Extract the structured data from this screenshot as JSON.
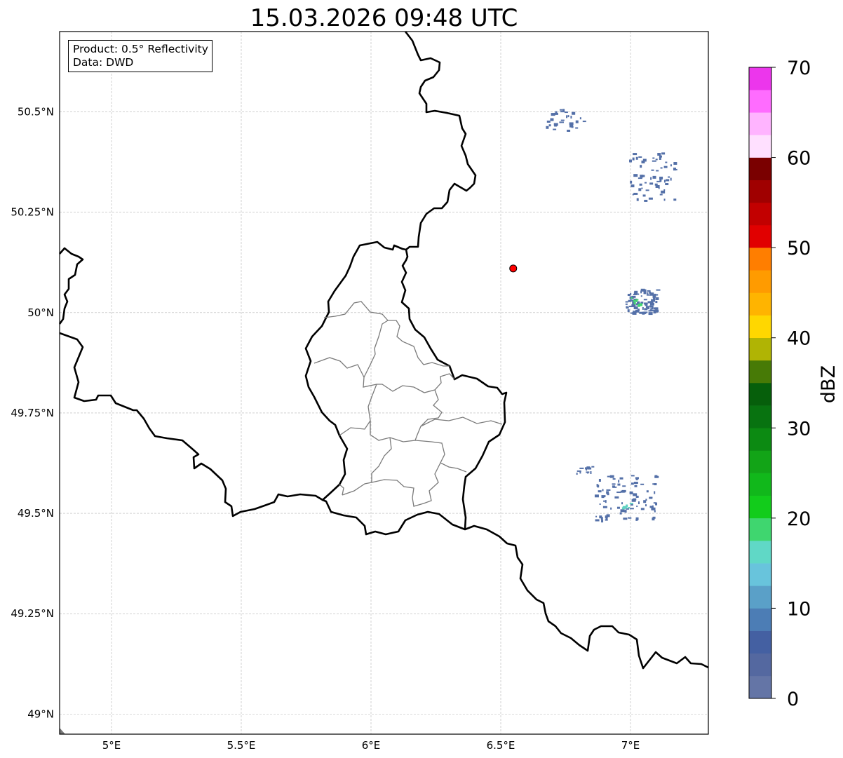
{
  "title": "15.03.2026 09:48 UTC",
  "info_box": {
    "product": "Product: 0.5° Reflectivity",
    "data": "Data: DWD"
  },
  "map": {
    "lon_range": [
      4.8,
      7.3
    ],
    "lat_range": [
      48.95,
      50.7
    ],
    "lon_ticks": [
      {
        "value": 5.0,
        "label": "5°E"
      },
      {
        "value": 5.5,
        "label": "5.5°E"
      },
      {
        "value": 6.0,
        "label": "6°E"
      },
      {
        "value": 6.5,
        "label": "6.5°E"
      },
      {
        "value": 7.0,
        "label": "7°E"
      }
    ],
    "lat_ticks": [
      {
        "value": 49.0,
        "label": "49°N"
      },
      {
        "value": 49.25,
        "label": "49.25°N"
      },
      {
        "value": 49.5,
        "label": "49.5°N"
      },
      {
        "value": 49.75,
        "label": "49.75°N"
      },
      {
        "value": 50.0,
        "label": "50°N"
      },
      {
        "value": 50.25,
        "label": "50.25°N"
      },
      {
        "value": 50.5,
        "label": "50.5°N"
      }
    ],
    "gridlines": true,
    "radar_site": {
      "lon": 6.548,
      "lat": 50.11,
      "color": "#ff0000"
    },
    "echoes": [
      {
        "lon": 6.74,
        "lat": 50.48,
        "spread_lon": 0.08,
        "spread_lat": 0.03,
        "count": 30,
        "color": "#5470a8"
      },
      {
        "lon": 7.08,
        "lat": 50.34,
        "spread_lon": 0.09,
        "spread_lat": 0.06,
        "count": 60,
        "color": "#5470a8"
      },
      {
        "lon": 7.04,
        "lat": 50.03,
        "spread_lon": 0.06,
        "spread_lat": 0.03,
        "count": 90,
        "color": "#5470a8"
      },
      {
        "lon": 7.02,
        "lat": 50.03,
        "spread_lon": 0.02,
        "spread_lat": 0.01,
        "count": 8,
        "color": "#3fd66f"
      },
      {
        "lon": 6.83,
        "lat": 49.61,
        "spread_lon": 0.04,
        "spread_lat": 0.01,
        "count": 12,
        "color": "#5470a8"
      },
      {
        "lon": 6.98,
        "lat": 49.54,
        "spread_lon": 0.12,
        "spread_lat": 0.06,
        "count": 90,
        "color": "#5470a8"
      },
      {
        "lon": 6.98,
        "lat": 49.52,
        "spread_lon": 0.02,
        "spread_lat": 0.01,
        "count": 5,
        "color": "#5fd2c2"
      }
    ]
  },
  "colorbar": {
    "label": "dBZ",
    "vmin": 0,
    "vmax": 70,
    "ticks": [
      {
        "value": 0,
        "label": "0"
      },
      {
        "value": 10,
        "label": "10"
      },
      {
        "value": 20,
        "label": "20"
      },
      {
        "value": 30,
        "label": "30"
      },
      {
        "value": 40,
        "label": "40"
      },
      {
        "value": 50,
        "label": "50"
      },
      {
        "value": 60,
        "label": "60"
      },
      {
        "value": 70,
        "label": "70"
      }
    ],
    "colors": [
      "#6475a6",
      "#5468a0",
      "#4460a2",
      "#4c7db5",
      "#5aa0c8",
      "#68c4dc",
      "#60d8c6",
      "#3fd66f",
      "#12cc1b",
      "#11b81b",
      "#12a417",
      "#0c8a12",
      "#087310",
      "#065f0b",
      "#477a06",
      "#b0b404",
      "#ffd700",
      "#ffb400",
      "#ff9b00",
      "#ff7e00",
      "#e10000",
      "#c20000",
      "#a00000",
      "#7a0000",
      "#ffe0ff",
      "#ffb4ff",
      "#ff6cff",
      "#ec36ec"
    ]
  }
}
